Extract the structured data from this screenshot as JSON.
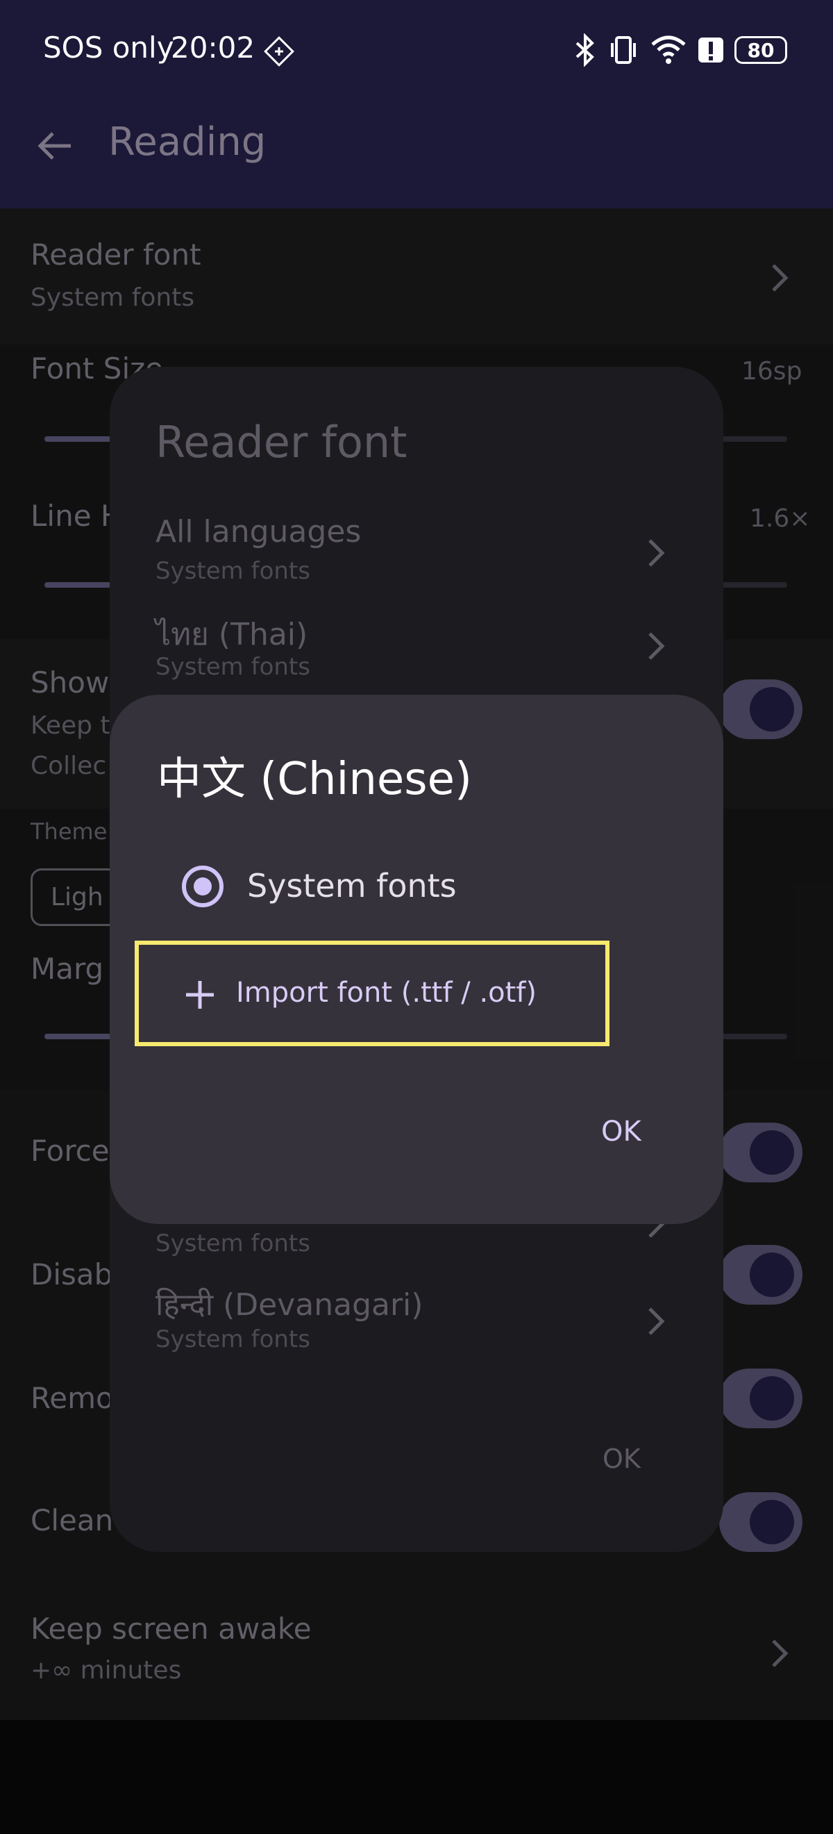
{
  "status_bar": {
    "carrier": "SOS only",
    "time": "20:02",
    "battery": "80",
    "icons": [
      "nfc-icon",
      "bluetooth-icon",
      "vibrate-icon",
      "wifi-icon",
      "alert-icon",
      "battery-icon"
    ]
  },
  "app_bar": {
    "title": "Reading",
    "back_icon": "arrow-left-icon"
  },
  "settings": {
    "reader_font": {
      "title": "Reader font",
      "subtitle": "System fonts"
    },
    "font_size": {
      "label": "Font Size",
      "value": "16sp"
    },
    "line_height": {
      "label": "Line H",
      "value": "1.6×"
    },
    "show": {
      "title": "Show",
      "sub1": "Keep t",
      "sub2": "Collec"
    },
    "theme": {
      "label": "Theme",
      "chip": "Ligh"
    },
    "margin": {
      "label": "Marg"
    },
    "force": {
      "title": "Force"
    },
    "disable": {
      "title": "Disab"
    },
    "remove": {
      "title": "Remo"
    },
    "clean": {
      "title": "Clean"
    },
    "keep_awake": {
      "title": "Keep screen awake",
      "subtitle": "+∞ minutes"
    }
  },
  "reader_font_dialog": {
    "title": "Reader font",
    "languages": [
      {
        "name": "All languages",
        "font": "System fonts"
      },
      {
        "name": "ไทย (Thai)",
        "font": "System fonts"
      },
      {
        "name": "",
        "font": "System fonts"
      },
      {
        "name": "हिन्दी (Devanagari)",
        "font": "System fonts"
      }
    ],
    "ok": "OK"
  },
  "chinese_dialog": {
    "title": "中文 (Chinese)",
    "option": "System fonts",
    "selected": true,
    "import_label": "Import font (.ttf / .otf)",
    "ok": "OK",
    "highlight_color": "#f7ea6e",
    "accent_color": "#cfc3f7"
  }
}
